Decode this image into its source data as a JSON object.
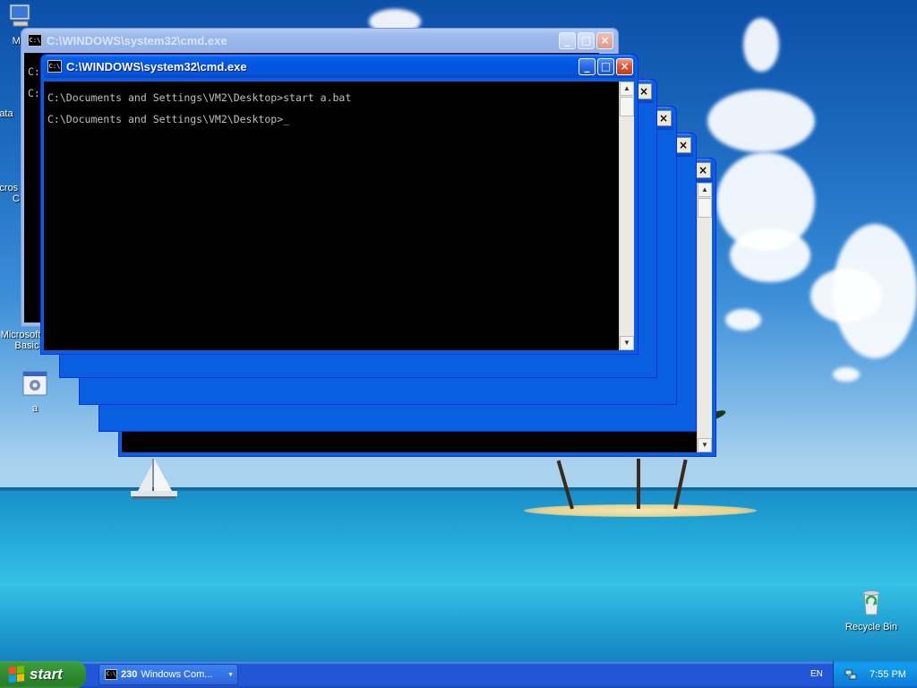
{
  "desktop": {
    "icons": [
      {
        "label": "My"
      },
      {
        "label": "Data"
      },
      {
        "label": "Micros"
      },
      {
        "label": "C"
      },
      {
        "label": "Microsoft"
      },
      {
        "label": "Basic"
      },
      {
        "label": "a"
      },
      {
        "label": "Recycle Bin"
      }
    ]
  },
  "windows": {
    "back": {
      "title": "C:\\WINDOWS\\system32\\cmd.exe",
      "lines": [
        "C:",
        "C:"
      ]
    },
    "front": {
      "title": "C:\\WINDOWS\\system32\\cmd.exe",
      "lines": [
        "C:\\Documents and Settings\\VM2\\Desktop>start a.bat",
        "C:\\Documents and Settings\\VM2\\Desktop>_"
      ]
    },
    "icon_text": "C:\\",
    "buttons": {
      "minimize": "_",
      "maximize": "□",
      "close": "×"
    }
  },
  "taskbar": {
    "start_label": "start",
    "task_button": {
      "count": "230",
      "label": "Windows Com..."
    },
    "language": "EN",
    "clock": "7:55 PM"
  },
  "colors": {
    "titlebar_active": "#0054e3",
    "start_green": "#2f8c2f",
    "tray_blue": "#0e7bd8"
  }
}
